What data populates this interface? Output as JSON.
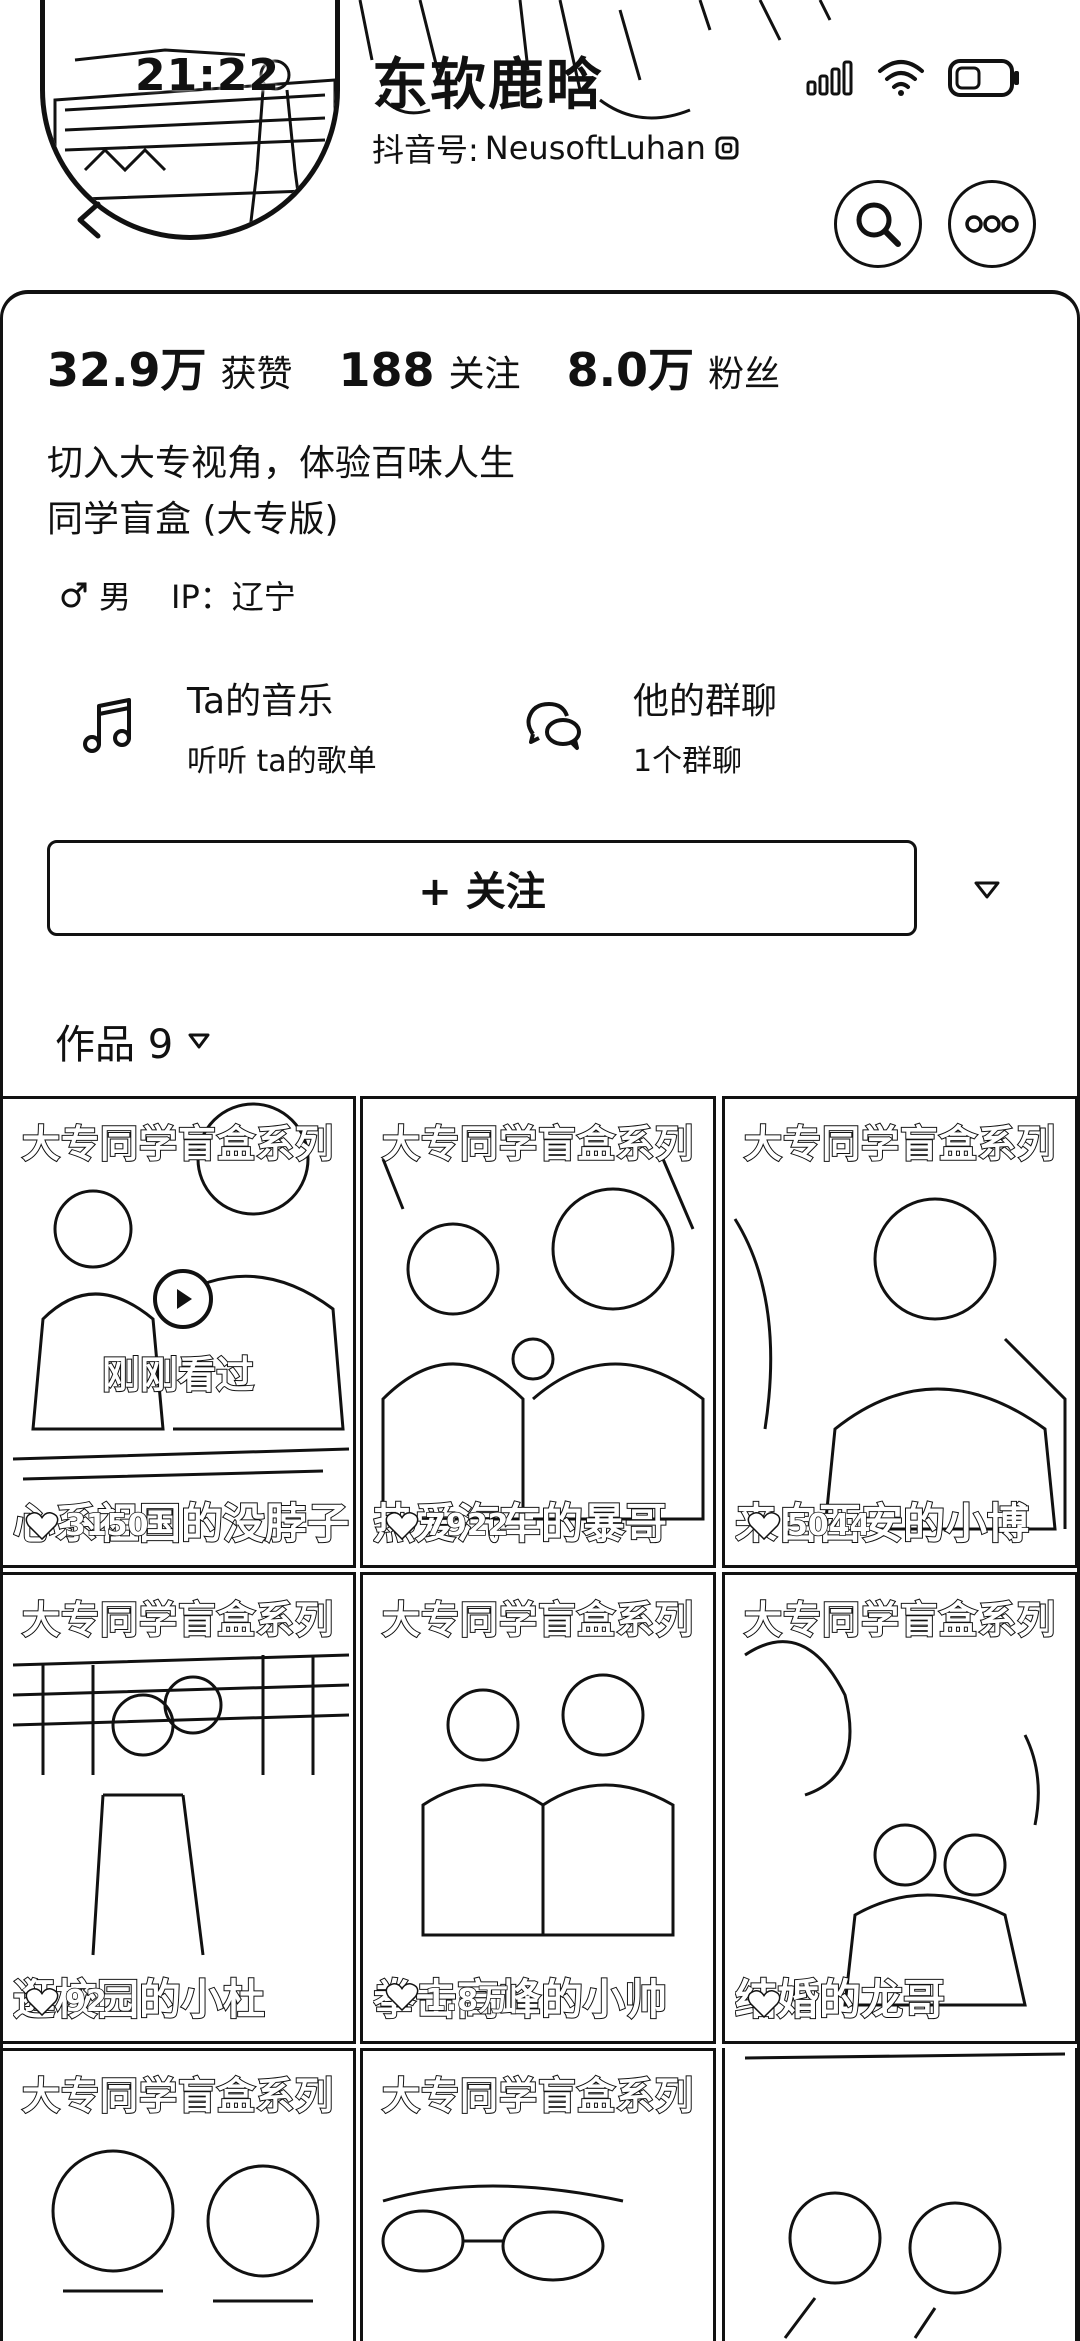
{
  "status_bar": {
    "time": "21:22",
    "icons": [
      "signal-icon",
      "wifi-icon",
      "battery-icon"
    ]
  },
  "profile": {
    "name": "东软鹿晗",
    "douyin_id_label": "抖音号:",
    "douyin_id": "NeusoftLuhan"
  },
  "stats": [
    {
      "value": "32.9万",
      "label": "获赞"
    },
    {
      "value": "188",
      "label": "关注"
    },
    {
      "value": "8.0万",
      "label": "粉丝"
    }
  ],
  "bio": {
    "line1": "切入大专视角，体验百味人生",
    "line2": "同学盲盒 (大专版)"
  },
  "meta": {
    "gender": "男",
    "ip": "IP：辽宁"
  },
  "features": {
    "music": {
      "title": "Ta的音乐",
      "subtitle": "听听 ta的歌单"
    },
    "group": {
      "title": "他的群聊",
      "subtitle": "1个群聊"
    }
  },
  "follow_button": "+ 关注",
  "works_tab": {
    "label": "作品 9"
  },
  "videos": [
    {
      "title": "大专同学盲盒系列",
      "caption": "心系祖国的没脖子",
      "likes": "3150",
      "watched": "刚刚看过"
    },
    {
      "title": "大专同学盲盒系列",
      "caption": "热爱汽车的暴哥",
      "likes": "7922",
      "watched": ""
    },
    {
      "title": "大专同学盲盒系列",
      "caption": "来自西安的小博",
      "likes": "5044",
      "watched": ""
    },
    {
      "title": "大专同学盲盒系列",
      "caption": "逛校园的小杜",
      "likes": "92",
      "watched": ""
    },
    {
      "title": "大专同学盲盒系列",
      "caption": "拳击高峰的小帅",
      "likes": "1.8万",
      "watched": ""
    },
    {
      "title": "大专同学盲盒系列",
      "caption": "结婚的龙哥",
      "likes": "",
      "watched": ""
    },
    {
      "title": "大专同学盲盒系列",
      "caption": "",
      "likes": "",
      "watched": ""
    },
    {
      "title": "大专同学盲盒系列",
      "caption": "",
      "likes": "",
      "watched": ""
    },
    {
      "title": "",
      "caption": "",
      "likes": "",
      "watched": ""
    }
  ]
}
